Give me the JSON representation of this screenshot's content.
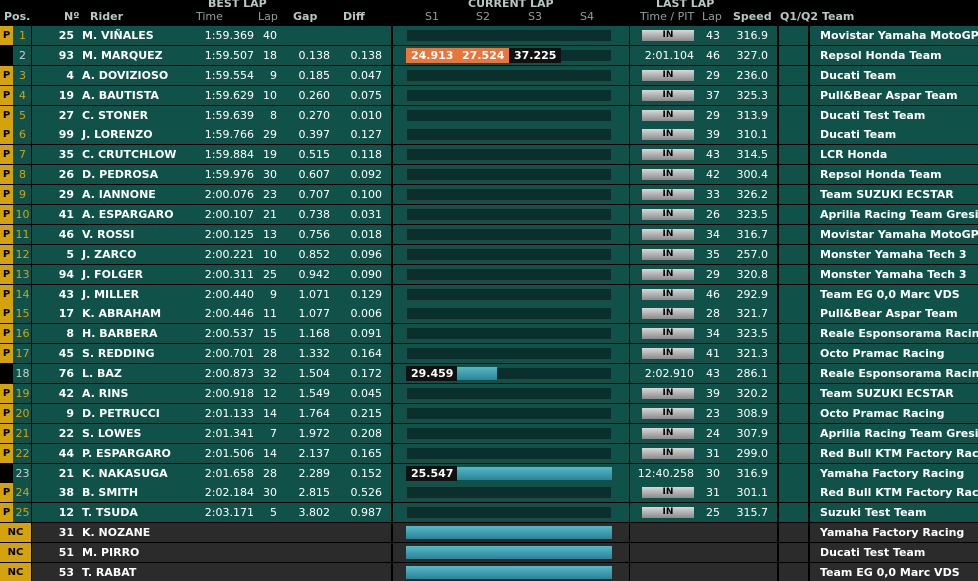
{
  "header": {
    "group_best_lap": "BEST LAP",
    "group_current_lap": "CURRENT LAP",
    "group_last_lap": "LAST LAP",
    "col_pos": "Pos.",
    "col_num": "Nº",
    "col_rider": "Rider",
    "col_time": "Time",
    "col_lap": "Lap",
    "col_gap": "Gap",
    "col_diff": "Diff",
    "col_s1": "S1",
    "col_s2": "S2",
    "col_s3": "S3",
    "col_s4": "S4",
    "col_time_pit": "Time / PIT",
    "col_last_lap": "Lap",
    "col_speed": "Speed",
    "col_q": "Q1/Q2",
    "col_team": "Team"
  },
  "colors": {
    "row_bg": "#10524a",
    "pit_badge": "#d4a20a",
    "orange_sector": "#e8763c",
    "nc_row_bg": "#2b2b2b"
  },
  "rows": [
    {
      "badge": "P",
      "pos": "1",
      "num": "25",
      "rider": "M. VIÑALES",
      "best_time": "1:59.369",
      "best_lap": "40",
      "gap": "",
      "diff": "",
      "pit": "IN",
      "last_time": "",
      "last_lap": "43",
      "speed": "316.9",
      "team": "Movistar Yamaha MotoGP"
    },
    {
      "badge": "",
      "pos": "2",
      "num": "93",
      "rider": "M. MARQUEZ",
      "best_time": "1:59.507",
      "best_lap": "18",
      "gap": "0.138",
      "diff": "0.138",
      "s1": "24.913",
      "s2": "27.524",
      "s3": "37.225",
      "pit": "",
      "last_time": "2:01.104",
      "last_lap": "46",
      "speed": "327.0",
      "team": "Repsol Honda Team"
    },
    {
      "badge": "P",
      "pos": "3",
      "num": "4",
      "rider": "A. DOVIZIOSO",
      "best_time": "1:59.554",
      "best_lap": "9",
      "gap": "0.185",
      "diff": "0.047",
      "pit": "IN",
      "last_time": "",
      "last_lap": "29",
      "speed": "236.0",
      "team": "Ducati Team"
    },
    {
      "badge": "P",
      "pos": "4",
      "num": "19",
      "rider": "A. BAUTISTA",
      "best_time": "1:59.629",
      "best_lap": "10",
      "gap": "0.260",
      "diff": "0.075",
      "pit": "IN",
      "last_time": "",
      "last_lap": "37",
      "speed": "325.3",
      "team": "Pull&Bear Aspar Team"
    },
    {
      "badge": "P",
      "pos": "5",
      "num": "27",
      "rider": "C. STONER",
      "best_time": "1:59.639",
      "best_lap": "8",
      "gap": "0.270",
      "diff": "0.010",
      "pit": "IN",
      "last_time": "",
      "last_lap": "29",
      "speed": "313.9",
      "team": "Ducati Test Team"
    },
    {
      "badge": "P",
      "pos": "6",
      "num": "99",
      "rider": "J. LORENZO",
      "best_time": "1:59.766",
      "best_lap": "29",
      "gap": "0.397",
      "diff": "0.127",
      "pit": "IN",
      "last_time": "",
      "last_lap": "39",
      "speed": "310.1",
      "team": "Ducati Team"
    },
    {
      "badge": "P",
      "pos": "7",
      "num": "35",
      "rider": "C. CRUTCHLOW",
      "best_time": "1:59.884",
      "best_lap": "19",
      "gap": "0.515",
      "diff": "0.118",
      "pit": "IN",
      "last_time": "",
      "last_lap": "43",
      "speed": "314.5",
      "team": "LCR Honda"
    },
    {
      "badge": "P",
      "pos": "8",
      "num": "26",
      "rider": "D. PEDROSA",
      "best_time": "1:59.976",
      "best_lap": "30",
      "gap": "0.607",
      "diff": "0.092",
      "pit": "IN",
      "last_time": "",
      "last_lap": "42",
      "speed": "300.4",
      "team": "Repsol Honda Team"
    },
    {
      "badge": "P",
      "pos": "9",
      "num": "29",
      "rider": "A. IANNONE",
      "best_time": "2:00.076",
      "best_lap": "23",
      "gap": "0.707",
      "diff": "0.100",
      "pit": "IN",
      "last_time": "",
      "last_lap": "33",
      "speed": "326.2",
      "team": "Team SUZUKI ECSTAR"
    },
    {
      "badge": "P",
      "pos": "10",
      "num": "41",
      "rider": "A. ESPARGARO",
      "best_time": "2:00.107",
      "best_lap": "21",
      "gap": "0.738",
      "diff": "0.031",
      "pit": "IN",
      "last_time": "",
      "last_lap": "26",
      "speed": "323.5",
      "team": "Aprilia Racing Team Gresini"
    },
    {
      "badge": "P",
      "pos": "11",
      "num": "46",
      "rider": "V. ROSSI",
      "best_time": "2:00.125",
      "best_lap": "13",
      "gap": "0.756",
      "diff": "0.018",
      "pit": "IN",
      "last_time": "",
      "last_lap": "34",
      "speed": "316.7",
      "team": "Movistar Yamaha MotoGP"
    },
    {
      "badge": "P",
      "pos": "12",
      "num": "5",
      "rider": "J. ZARCO",
      "best_time": "2:00.221",
      "best_lap": "10",
      "gap": "0.852",
      "diff": "0.096",
      "pit": "IN",
      "last_time": "",
      "last_lap": "35",
      "speed": "257.0",
      "team": "Monster Yamaha Tech 3"
    },
    {
      "badge": "P",
      "pos": "13",
      "num": "94",
      "rider": "J. FOLGER",
      "best_time": "2:00.311",
      "best_lap": "25",
      "gap": "0.942",
      "diff": "0.090",
      "pit": "IN",
      "last_time": "",
      "last_lap": "29",
      "speed": "320.8",
      "team": "Monster Yamaha Tech 3"
    },
    {
      "badge": "P",
      "pos": "14",
      "num": "43",
      "rider": "J. MILLER",
      "best_time": "2:00.440",
      "best_lap": "9",
      "gap": "1.071",
      "diff": "0.129",
      "pit": "IN",
      "last_time": "",
      "last_lap": "46",
      "speed": "292.9",
      "team": "Team EG 0,0 Marc VDS"
    },
    {
      "badge": "P",
      "pos": "15",
      "num": "17",
      "rider": "K. ABRAHAM",
      "best_time": "2:00.446",
      "best_lap": "11",
      "gap": "1.077",
      "diff": "0.006",
      "pit": "IN",
      "last_time": "",
      "last_lap": "28",
      "speed": "321.7",
      "team": "Pull&Bear Aspar Team"
    },
    {
      "badge": "P",
      "pos": "16",
      "num": "8",
      "rider": "H. BARBERA",
      "best_time": "2:00.537",
      "best_lap": "15",
      "gap": "1.168",
      "diff": "0.091",
      "pit": "IN",
      "last_time": "",
      "last_lap": "34",
      "speed": "323.5",
      "team": "Reale Esponsorama Racing"
    },
    {
      "badge": "P",
      "pos": "17",
      "num": "45",
      "rider": "S. REDDING",
      "best_time": "2:00.701",
      "best_lap": "28",
      "gap": "1.332",
      "diff": "0.164",
      "pit": "IN",
      "last_time": "",
      "last_lap": "41",
      "speed": "321.3",
      "team": "Octo Pramac Racing"
    },
    {
      "badge": "",
      "pos": "18",
      "num": "76",
      "rider": "L. BAZ",
      "best_time": "2:00.873",
      "best_lap": "32",
      "gap": "1.504",
      "diff": "0.172",
      "s1": "29.459",
      "pit": "",
      "last_time": "2:02.910",
      "last_lap": "43",
      "speed": "286.1",
      "team": "Reale Esponsorama Racing"
    },
    {
      "badge": "P",
      "pos": "19",
      "num": "42",
      "rider": "A. RINS",
      "best_time": "2:00.918",
      "best_lap": "12",
      "gap": "1.549",
      "diff": "0.045",
      "pit": "IN",
      "last_time": "",
      "last_lap": "39",
      "speed": "320.2",
      "team": "Team SUZUKI ECSTAR"
    },
    {
      "badge": "P",
      "pos": "20",
      "num": "9",
      "rider": "D. PETRUCCI",
      "best_time": "2:01.133",
      "best_lap": "14",
      "gap": "1.764",
      "diff": "0.215",
      "pit": "IN",
      "last_time": "",
      "last_lap": "23",
      "speed": "308.9",
      "team": "Octo Pramac Racing"
    },
    {
      "badge": "P",
      "pos": "21",
      "num": "22",
      "rider": "S. LOWES",
      "best_time": "2:01.341",
      "best_lap": "7",
      "gap": "1.972",
      "diff": "0.208",
      "pit": "IN",
      "last_time": "",
      "last_lap": "24",
      "speed": "307.9",
      "team": "Aprilia Racing Team Gresini"
    },
    {
      "badge": "P",
      "pos": "22",
      "num": "44",
      "rider": "P. ESPARGARO",
      "best_time": "2:01.506",
      "best_lap": "14",
      "gap": "2.137",
      "diff": "0.165",
      "pit": "IN",
      "last_time": "",
      "last_lap": "31",
      "speed": "299.0",
      "team": "Red Bull KTM Factory Racin"
    },
    {
      "badge": "",
      "pos": "23",
      "num": "21",
      "rider": "K. NAKASUGA",
      "best_time": "2:01.658",
      "best_lap": "28",
      "gap": "2.289",
      "diff": "0.152",
      "s1": "25.547",
      "pit": "",
      "last_time": "12:40.258",
      "last_lap": "30",
      "speed": "316.9",
      "team": "Yamaha Factory Racing"
    },
    {
      "badge": "P",
      "pos": "24",
      "num": "38",
      "rider": "B. SMITH",
      "best_time": "2:02.184",
      "best_lap": "30",
      "gap": "2.815",
      "diff": "0.526",
      "pit": "IN",
      "last_time": "",
      "last_lap": "31",
      "speed": "301.1",
      "team": "Red Bull KTM Factory Racin"
    },
    {
      "badge": "P",
      "pos": "25",
      "num": "12",
      "rider": "T. TSUDA",
      "best_time": "2:03.171",
      "best_lap": "5",
      "gap": "3.802",
      "diff": "0.987",
      "pit": "IN",
      "last_time": "",
      "last_lap": "25",
      "speed": "315.7",
      "team": "Suzuki Test Team"
    },
    {
      "badge": "NC",
      "pos": "",
      "num": "31",
      "rider": "K. NOZANE",
      "best_time": "",
      "best_lap": "",
      "gap": "",
      "diff": "",
      "pit": "",
      "last_time": "",
      "last_lap": "",
      "speed": "",
      "team": "Yamaha Factory Racing"
    },
    {
      "badge": "NC",
      "pos": "",
      "num": "51",
      "rider": "M. PIRRO",
      "best_time": "",
      "best_lap": "",
      "gap": "",
      "diff": "",
      "pit": "",
      "last_time": "",
      "last_lap": "",
      "speed": "",
      "team": "Ducati Test Team"
    },
    {
      "badge": "NC",
      "pos": "",
      "num": "53",
      "rider": "T. RABAT",
      "best_time": "",
      "best_lap": "",
      "gap": "",
      "diff": "",
      "pit": "",
      "last_time": "",
      "last_lap": "",
      "speed": "",
      "team": "Team EG 0,0 Marc VDS"
    }
  ]
}
